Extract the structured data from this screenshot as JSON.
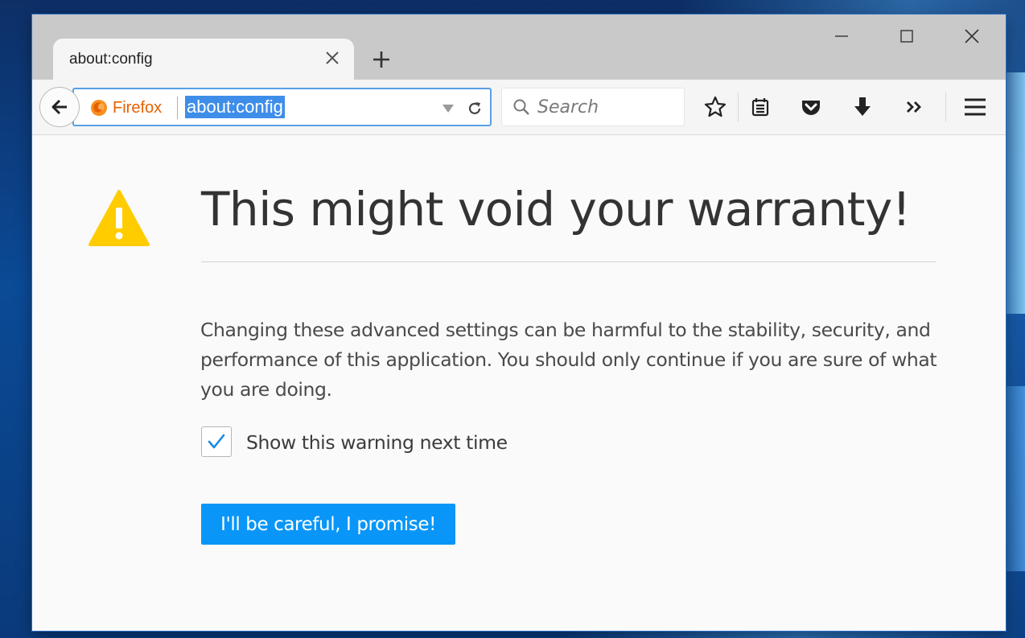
{
  "tab": {
    "title": "about:config"
  },
  "urlbar": {
    "identity_label": "Firefox",
    "url": "about:config"
  },
  "search": {
    "placeholder": "Search"
  },
  "content": {
    "title": "This might void your warranty!",
    "body": "Changing these advanced settings can be harmful to the stability, security, and performance of this application. You should only continue if you are sure of what you are doing.",
    "checkbox_label": "Show this warning next time",
    "checkbox_checked": true,
    "button_label": "I'll be careful, I promise!"
  },
  "colors": {
    "accent": "#0996f8",
    "warning": "#ffcc00",
    "firefox_orange": "#e66000",
    "url_selection": "#3e8ee9"
  },
  "icons": {
    "tab_close": "close-icon",
    "new_tab": "plus-icon",
    "back": "arrow-left-icon",
    "identity": "firefox-logo-icon",
    "dropdown": "triangle-down-icon",
    "reload": "reload-icon",
    "search": "magnifier-icon",
    "bookmark": "star-icon",
    "library": "library-icon",
    "pocket": "pocket-icon",
    "downloads": "download-arrow-icon",
    "overflow": "double-chevron-icon",
    "menu": "hamburger-icon",
    "warning": "warning-triangle-icon",
    "check": "checkmark-icon"
  }
}
